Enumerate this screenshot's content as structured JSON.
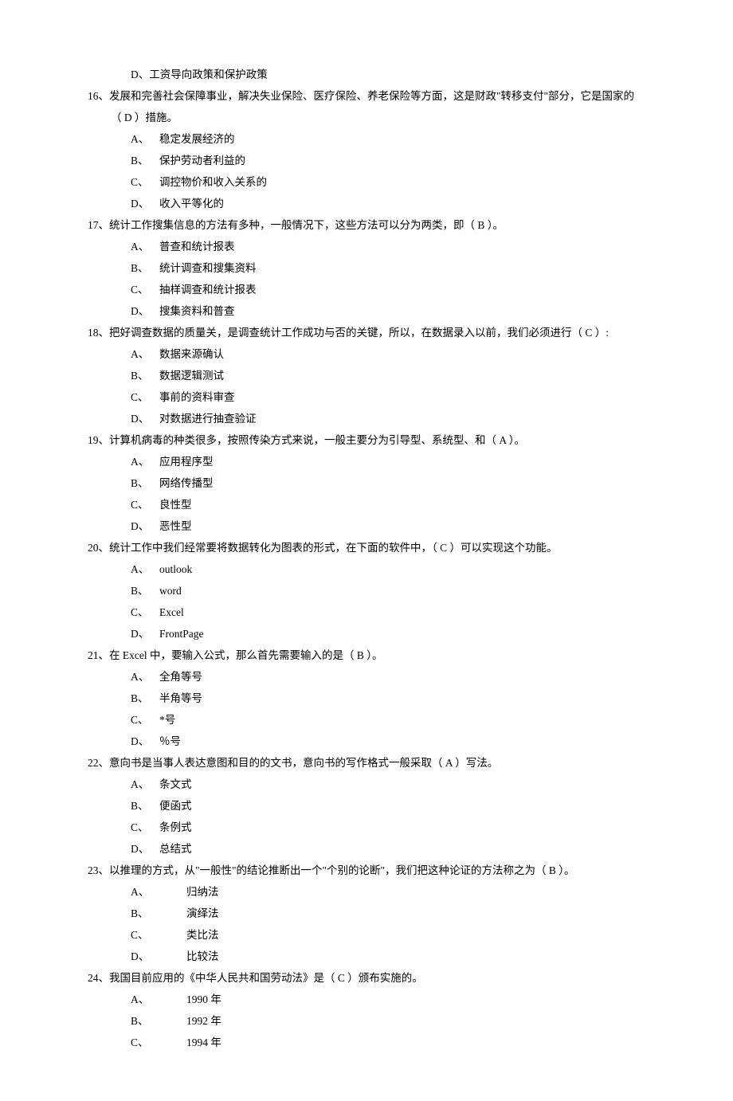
{
  "orphan": {
    "d": "D、工资导向政策和保护政策"
  },
  "q16": {
    "num": "16、",
    "text_a": "发展和完善社会保障事业，解决失业保险、医疗保险、养老保险等方面，这是财政\"转移支付\"部分，它是国家的",
    "text_b": "（ D ）措施。",
    "a": "稳定发展经济的",
    "b": "保护劳动者利益的",
    "c": "调控物价和收入关系的",
    "d": "收入平等化的"
  },
  "q17": {
    "num": "17、",
    "text": "统计工作搜集信息的方法有多种，一般情况下，这些方法可以分为两类，即（ B ）。",
    "a": "普查和统计报表",
    "b": "统计调查和搜集资料",
    "c": "抽样调查和统计报表",
    "d": "搜集资料和普查"
  },
  "q18": {
    "num": "18、",
    "text": "把好调查数据的质量关，是调查统计工作成功与否的关键，所以，在数据录入以前，我们必须进行（ C ）:",
    "a": "数据来源确认",
    "b": "数据逻辑测试",
    "c": "事前的资料审查",
    "d": "对数据进行抽查验证"
  },
  "q19": {
    "num": "19、",
    "text": "计算机病毒的种类很多，按照传染方式来说，一般主要分为引导型、系统型、和（ A ）。",
    "a": "应用程序型",
    "b": "网络传播型",
    "c": "良性型",
    "d": "恶性型"
  },
  "q20": {
    "num": "20、",
    "text": "统计工作中我们经常要将数据转化为图表的形式，在下面的软件中，（ C ）可以实现这个功能。",
    "a": "outlook",
    "b": "word",
    "c": "Excel",
    "d": "FrontPage"
  },
  "q21": {
    "num": "21、",
    "text": "在 Excel 中，要输入公式，那么首先需要输入的是（ B ）。",
    "a": "全角等号",
    "b": "半角等号",
    "c": "*号",
    "d": "％号"
  },
  "q22": {
    "num": "22、",
    "text": "意向书是当事人表达意图和目的的文书，意向书的写作格式一般采取（ A ）写法。",
    "a": "条文式",
    "b": "便函式",
    "c": "条例式",
    "d": "总结式"
  },
  "q23": {
    "num": "23、",
    "text": "以推理的方式，从\"一般性\"的结论推断出一个\"个别的论断\"，我们把这种论证的方法称之为（ B ）。",
    "a": "归纳法",
    "b": "演绎法",
    "c": "类比法",
    "d": "比较法"
  },
  "q24": {
    "num": "24、",
    "text": "我国目前应用的《中华人民共和国劳动法》是（ C ）颁布实施的。",
    "a": "1990 年",
    "b": "1992 年",
    "c": "1994 年"
  },
  "labels": {
    "a": "A、",
    "b": "B、",
    "c": "C、",
    "d": "D、"
  }
}
